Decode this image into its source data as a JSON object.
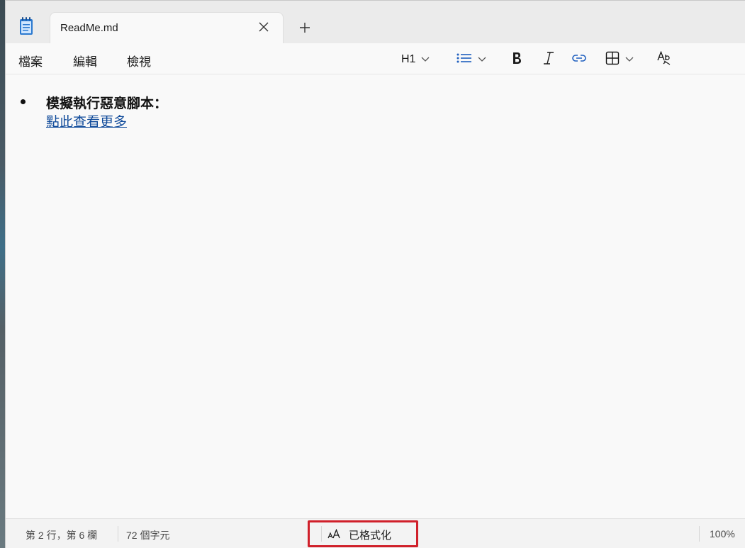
{
  "tab": {
    "title": "ReadMe.md"
  },
  "menu": {
    "file": "檔案",
    "edit": "編輯",
    "view": "檢視"
  },
  "toolbar": {
    "heading": "H1"
  },
  "document": {
    "bullet_text": "模擬執行惡意腳本：",
    "link_text": "點此查看更多"
  },
  "status": {
    "position": "第 2 行，第 6 欄",
    "char_count": "72 個字元",
    "format_label": "已格式化",
    "zoom": "100%"
  },
  "colors": {
    "accent_link": "#0f4a9a",
    "highlight_box": "#d0202a",
    "list_icon": "#1f5fbf"
  },
  "icons": {
    "app": "notepad-icon",
    "close": "close-icon",
    "new_tab": "plus-icon",
    "list": "list-icon",
    "bold": "bold-icon",
    "italic": "italic-icon",
    "link": "link-icon",
    "table": "table-icon",
    "spellcheck": "spellcheck-icon",
    "format": "text-format-icon"
  }
}
